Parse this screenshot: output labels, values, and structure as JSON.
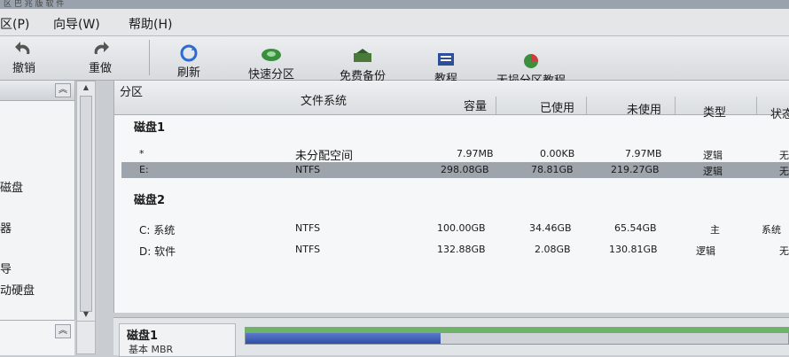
{
  "window": {
    "title": "区 巴 兆 版 软 件"
  },
  "menu": {
    "items": [
      "区(P)",
      "向导(W)",
      "帮助(H)"
    ]
  },
  "toolbar": {
    "undo": "撤销",
    "redo": "重做",
    "refresh": "刷新",
    "quick_partition": "快速分区",
    "free_backup": "免费备份",
    "tutorial": "教程",
    "lossless_tutorial": "无损分区教程"
  },
  "left_panel": {
    "items": [
      "磁盘",
      "器",
      "导",
      "动硬盘"
    ]
  },
  "table": {
    "columns": [
      "分区",
      "文件系统",
      "容量",
      "已使用",
      "未使用",
      "类型",
      "状态"
    ],
    "groups": [
      {
        "title": "磁盘1",
        "rows": [
          {
            "partition": "*",
            "filesystem": "未分配空间",
            "capacity": "7.97MB",
            "used": "0.00KB",
            "free": "7.97MB",
            "type": "逻辑",
            "status": "无"
          },
          {
            "partition": "E:",
            "filesystem": "NTFS",
            "capacity": "298.08GB",
            "used": "78.81GB",
            "free": "219.27GB",
            "type": "逻辑",
            "status": "无",
            "selected": true
          }
        ]
      },
      {
        "title": "磁盘2",
        "rows": [
          {
            "partition": "C: 系统",
            "filesystem": "NTFS",
            "capacity": "100.00GB",
            "used": "34.46GB",
            "free": "65.54GB",
            "type": "主",
            "status": "系统"
          },
          {
            "partition": "D: 软件",
            "filesystem": "NTFS",
            "capacity": "132.88GB",
            "used": "2.08GB",
            "free": "130.81GB",
            "type": "逻辑",
            "status": "无"
          }
        ]
      }
    ]
  },
  "disk_map": {
    "disk_name": "磁盘1",
    "disk_info": "基本 MBR",
    "used_fraction": 0.36
  },
  "colors": {
    "selection": "#9ea4ab",
    "bar_fill": "#2f4ea7",
    "bar_top": "#6fb36a"
  },
  "icons": [
    "undo-icon",
    "redo-icon",
    "refresh-icon",
    "disk-icon",
    "backup-icon",
    "book-icon",
    "pie-icon"
  ]
}
